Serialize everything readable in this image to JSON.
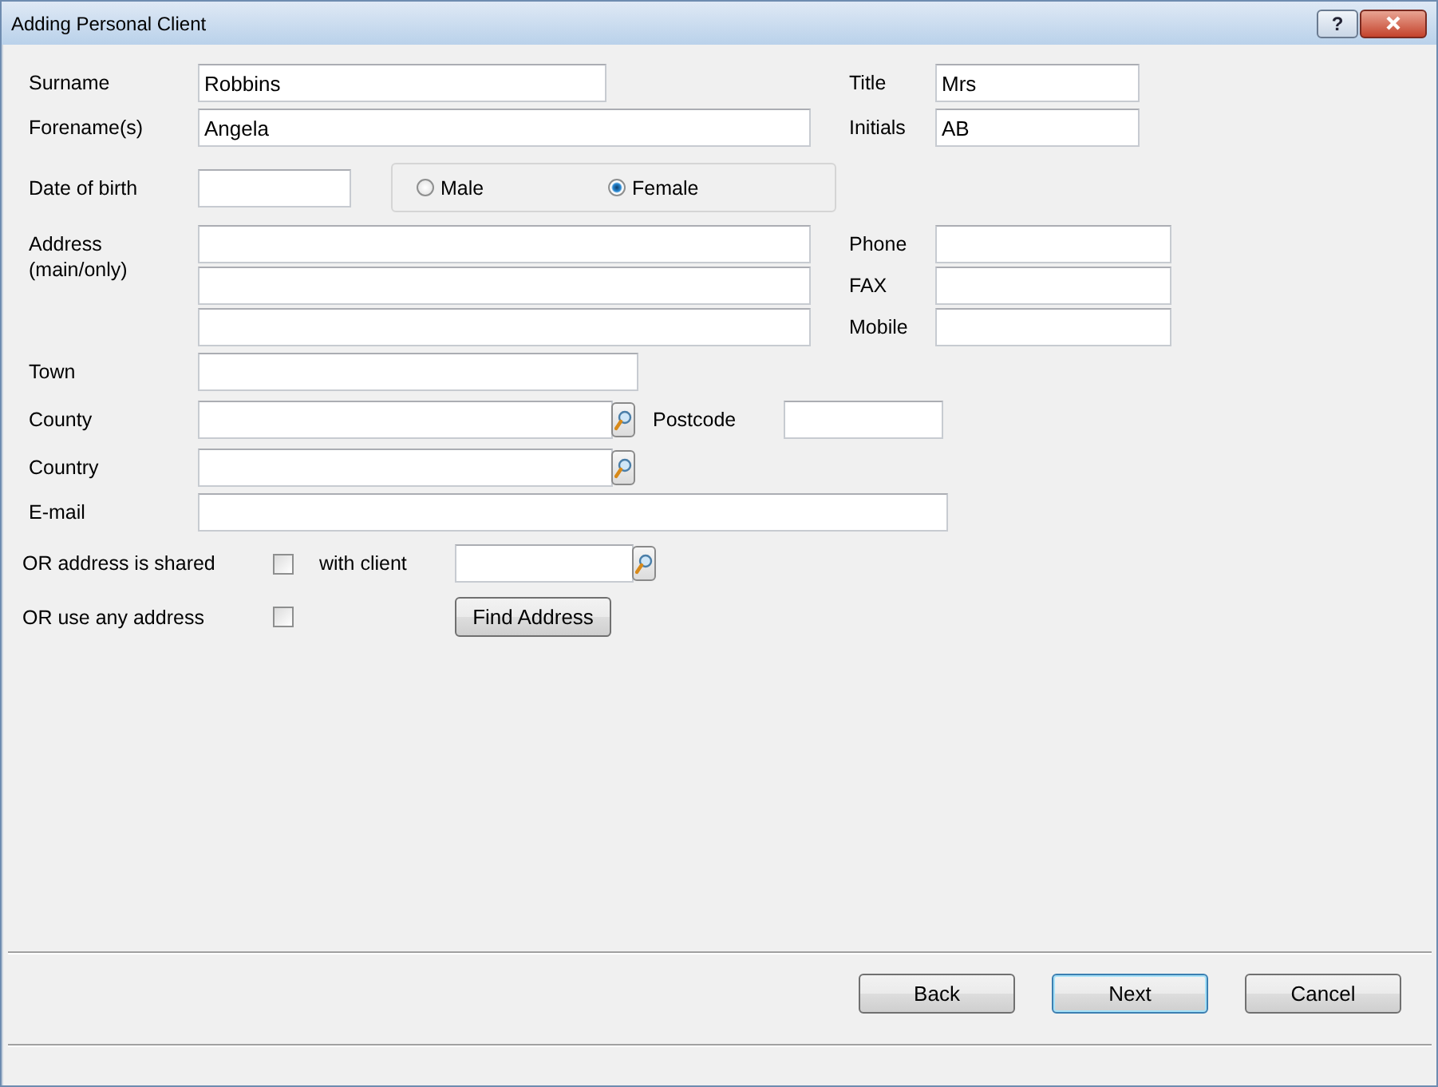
{
  "window": {
    "title": "Adding Personal Client",
    "help": "?"
  },
  "surname": {
    "label": "Surname",
    "value": "Robbins"
  },
  "title": {
    "label": "Title",
    "value": "Mrs"
  },
  "forename": {
    "label": "Forename(s)",
    "value": "Angela"
  },
  "initials": {
    "label": "Initials",
    "value": "AB"
  },
  "dob": {
    "label": "Date of birth"
  },
  "gender": [
    {
      "label": "Male",
      "selected": false
    },
    {
      "label": "Female",
      "selected": true
    }
  ],
  "address": {
    "label": "Address\n(main/only)"
  },
  "phone": {
    "label": "Phone"
  },
  "fax": {
    "label": "FAX"
  },
  "mobile": {
    "label": "Mobile"
  },
  "town": {
    "label": "Town"
  },
  "county": {
    "label": "County"
  },
  "postcode": {
    "label": "Postcode"
  },
  "country": {
    "label": "Country"
  },
  "email": {
    "label": "E-mail"
  },
  "shared": {
    "label": "OR address is shared",
    "checked": false,
    "with_label": "with client"
  },
  "any_address": {
    "label": "OR use any address",
    "checked": false,
    "button": "Find Address"
  },
  "buttons": [
    {
      "label": "Back",
      "default": false
    },
    {
      "label": "Next",
      "default": true
    },
    {
      "label": "Cancel",
      "default": false
    }
  ]
}
